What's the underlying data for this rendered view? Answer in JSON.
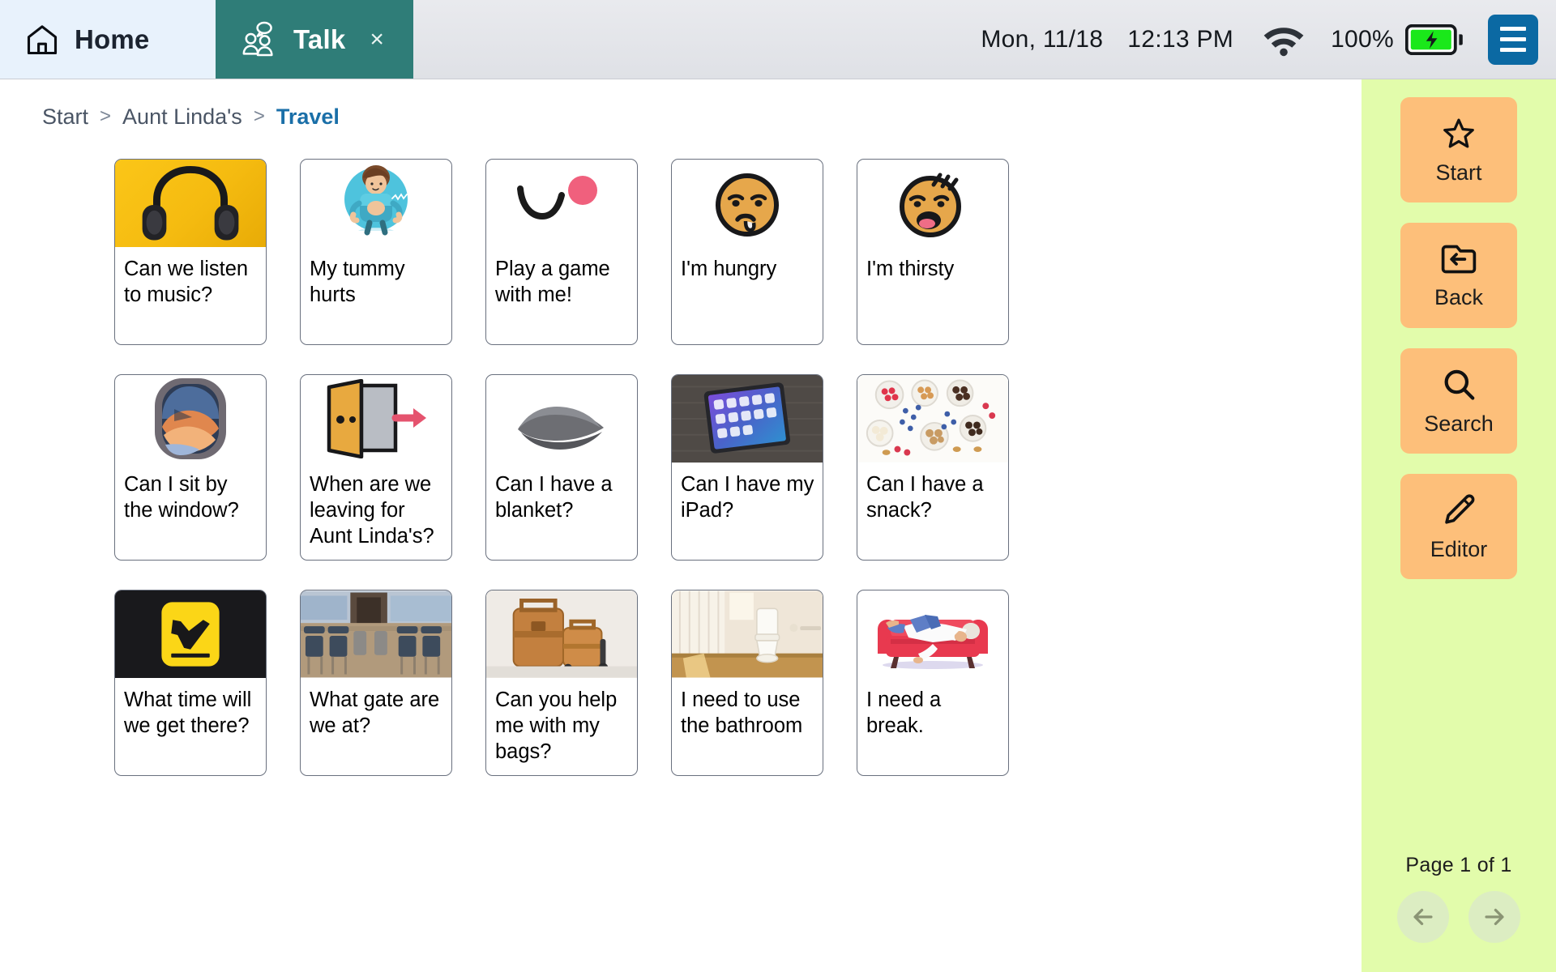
{
  "topbar": {
    "tabs": [
      {
        "label": "Home",
        "icon": "home-icon",
        "active": false
      },
      {
        "label": "Talk",
        "icon": "people-talking-icon",
        "active": true,
        "close": "×"
      }
    ],
    "status": {
      "date": "Mon,  11/18",
      "time": "12:13 PM",
      "wifi_icon": "wifi-icon",
      "battery_percent": "100%",
      "battery_icon": "battery-charging-icon",
      "menu_icon": "hamburger-menu-icon"
    },
    "colors": {
      "home_tab": "#e8f2fc",
      "talk_tab": "#2f7d78",
      "menu_button": "#0b69a3"
    }
  },
  "breadcrumb": {
    "items": [
      "Start",
      "Aunt Linda's",
      "Travel"
    ],
    "separator": ">",
    "current_index": 2,
    "current_color": "#1a6fa8"
  },
  "grid": {
    "cards": [
      {
        "label": "Can we listen to music?",
        "image": "headphones-photo"
      },
      {
        "label": "My tummy hurts",
        "image": "tummy-ache-symbol"
      },
      {
        "label": "Play a game with me!",
        "image": "ball-bounce-symbol"
      },
      {
        "label": "I'm hungry",
        "image": "hungry-face-emoji"
      },
      {
        "label": "I'm thirsty",
        "image": "thirsty-face-emoji"
      },
      {
        "label": "Can I sit by the window?",
        "image": "airplane-window-photo"
      },
      {
        "label": "When are we leaving for Aunt Linda's?",
        "image": "open-door-exit-symbol"
      },
      {
        "label": "Can I have a blanket?",
        "image": "gray-blanket-photo"
      },
      {
        "label": "Can I have my iPad?",
        "image": "ipad-tablet-photo"
      },
      {
        "label": "Can I have a snack?",
        "image": "snack-bowls-photo"
      },
      {
        "label": "What time will we get there?",
        "image": "arrivals-sign-photo"
      },
      {
        "label": "What gate are we at?",
        "image": "airport-gate-seating-photo"
      },
      {
        "label": "Can you help me with my bags?",
        "image": "luggage-photo"
      },
      {
        "label": "I need to use the bathroom",
        "image": "bathroom-photo"
      },
      {
        "label": "I need a break.",
        "image": "person-resting-on-couch-illustration"
      }
    ],
    "card_border_color": "#69707e"
  },
  "sidebar": {
    "background_color": "#e2fcab",
    "button_color": "#fdbf7a",
    "buttons": [
      {
        "label": "Start",
        "icon": "star-icon"
      },
      {
        "label": "Back",
        "icon": "folder-back-arrow-icon"
      },
      {
        "label": "Search",
        "icon": "magnifier-icon"
      },
      {
        "label": "Editor",
        "icon": "pencil-icon"
      }
    ],
    "pager": {
      "text": "Page 1 of 1",
      "prev_icon": "arrow-left-icon",
      "next_icon": "arrow-right-icon"
    }
  }
}
